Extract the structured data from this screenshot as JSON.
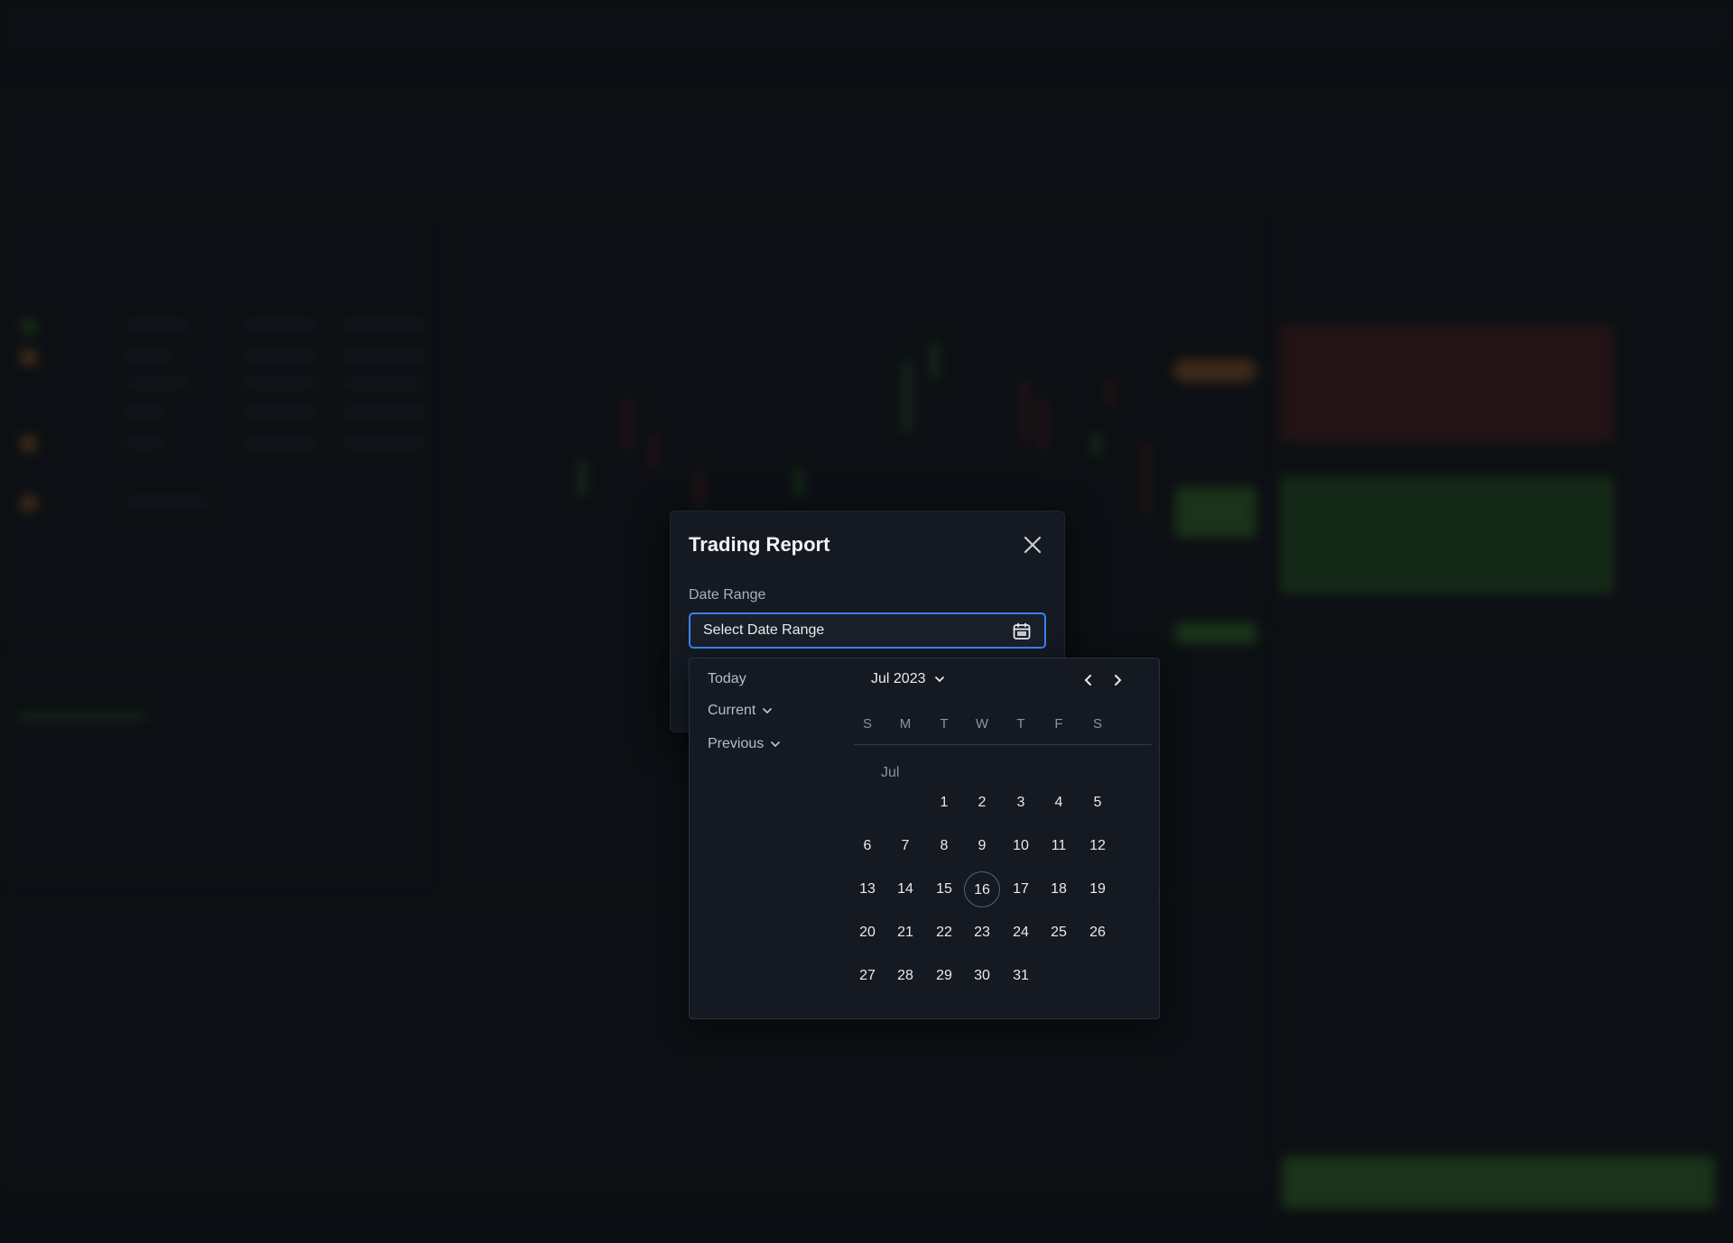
{
  "modal": {
    "title": "Trading Report",
    "date_range_label": "Date Range",
    "date_range_placeholder": "Select Date Range"
  },
  "calendar": {
    "presets": [
      {
        "label": "Today",
        "has_dropdown": false
      },
      {
        "label": "Current",
        "has_dropdown": true
      },
      {
        "label": "Previous",
        "has_dropdown": true
      }
    ],
    "month_year": "Jul 2023",
    "month_label": "Jul",
    "weekdays": [
      "S",
      "M",
      "T",
      "W",
      "T",
      "F",
      "S"
    ],
    "first_weekday_index": 2,
    "days_in_month": 31,
    "highlighted_day": 16
  },
  "colors": {
    "modal_bg": "#141922",
    "input_border": "#3b82f6",
    "page_bg": "#0e1116"
  }
}
